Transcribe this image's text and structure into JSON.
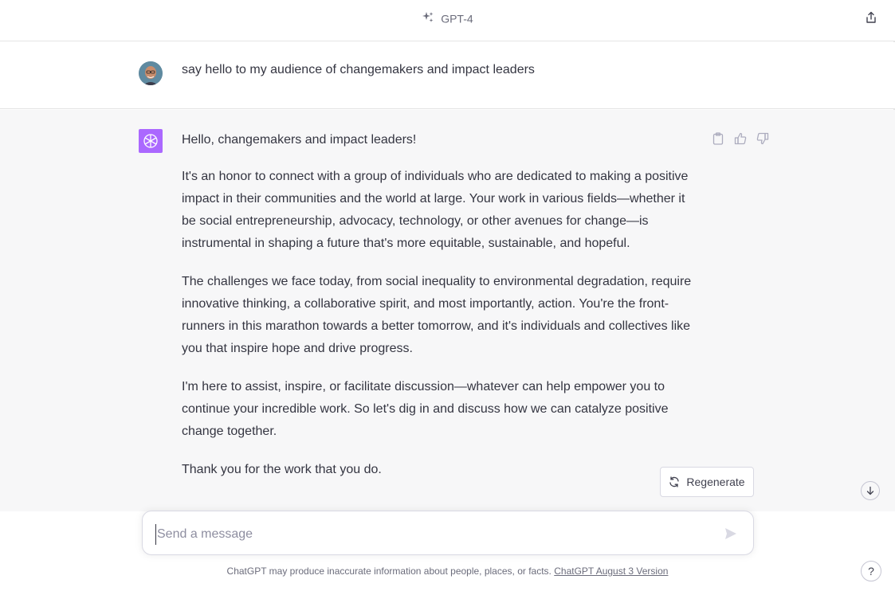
{
  "header": {
    "model_label": "GPT-4",
    "model_icon": "sparkles-icon",
    "share_icon": "share-icon"
  },
  "conversation": {
    "user_message": "say hello to my audience of changemakers and impact leaders",
    "assistant_paragraphs": [
      "Hello, changemakers and impact leaders!",
      "It's an honor to connect with a group of individuals who are dedicated to making a positive impact in their communities and the world at large. Your work in various fields—whether it be social entrepreneurship, advocacy, technology, or other avenues for change—is instrumental in shaping a future that's more equitable, sustainable, and hopeful.",
      "The challenges we face today, from social inequality to environmental degradation, require innovative thinking, a collaborative spirit, and most importantly, action. You're the front-runners in this marathon towards a better tomorrow, and it's individuals and collectives like you that inspire hope and drive progress.",
      "I'm here to assist, inspire, or facilitate discussion—whatever can help empower you to continue your incredible work. So let's dig in and discuss how we can catalyze positive change together.",
      "Thank you for the work that you do."
    ]
  },
  "actions": {
    "regenerate_label": "Regenerate"
  },
  "composer": {
    "placeholder": "Send a message",
    "value": ""
  },
  "footer": {
    "disclaimer": "ChatGPT may produce inaccurate information about people, places, or facts.",
    "version_link": "ChatGPT August 3 Version",
    "help_label": "?"
  },
  "colors": {
    "gpt_logo_bg": "#ab68ff",
    "assistant_bg": "#f7f7f8",
    "text": "#343541"
  }
}
